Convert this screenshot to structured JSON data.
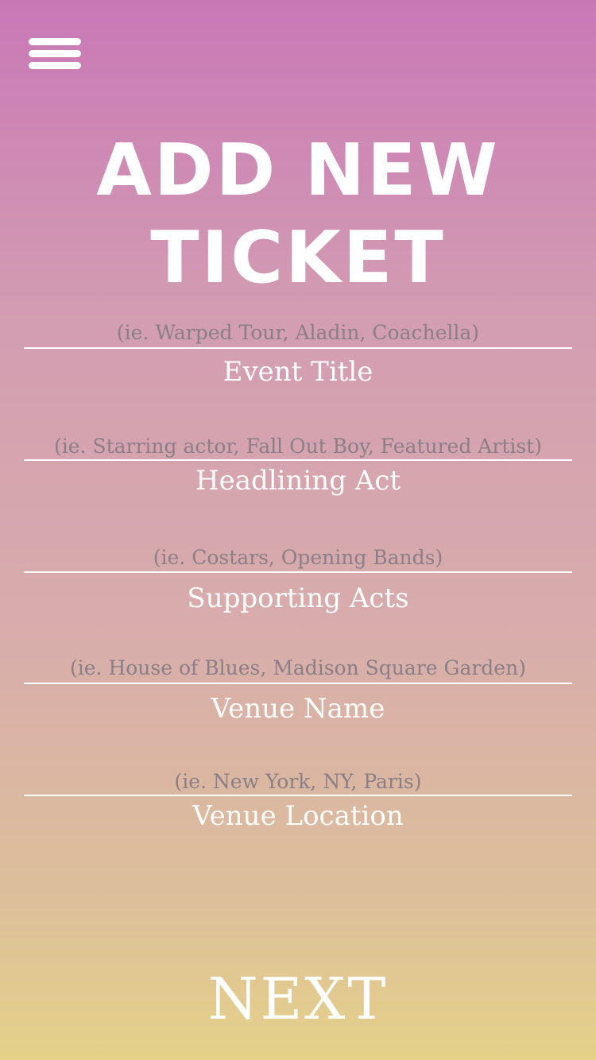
{
  "header": {
    "menu_icon": "hamburger-menu-icon",
    "title": "ADD NEW TICKET"
  },
  "form": {
    "fields": [
      {
        "placeholder": "(ie. Warped Tour, Aladin, Coachella)",
        "label": "Event Title"
      },
      {
        "placeholder": "(ie. Starring actor, Fall Out Boy, Featured Artist)",
        "label": "Headlining Act"
      },
      {
        "placeholder": "(ie. Costars, Opening Bands)",
        "label": "Supporting Acts"
      },
      {
        "placeholder": "(ie. House of Blues, Madison Square Garden)",
        "label": "Venue Name"
      },
      {
        "placeholder": "(ie. New York, NY, Paris)",
        "label": "Venue Location"
      }
    ]
  },
  "footer": {
    "next_label": "NEXT"
  },
  "colors": {
    "gradient_top": "#c978b6",
    "gradient_bottom": "#e5d189",
    "placeholder_text": "#8a7f86",
    "text": "#ffffff"
  }
}
